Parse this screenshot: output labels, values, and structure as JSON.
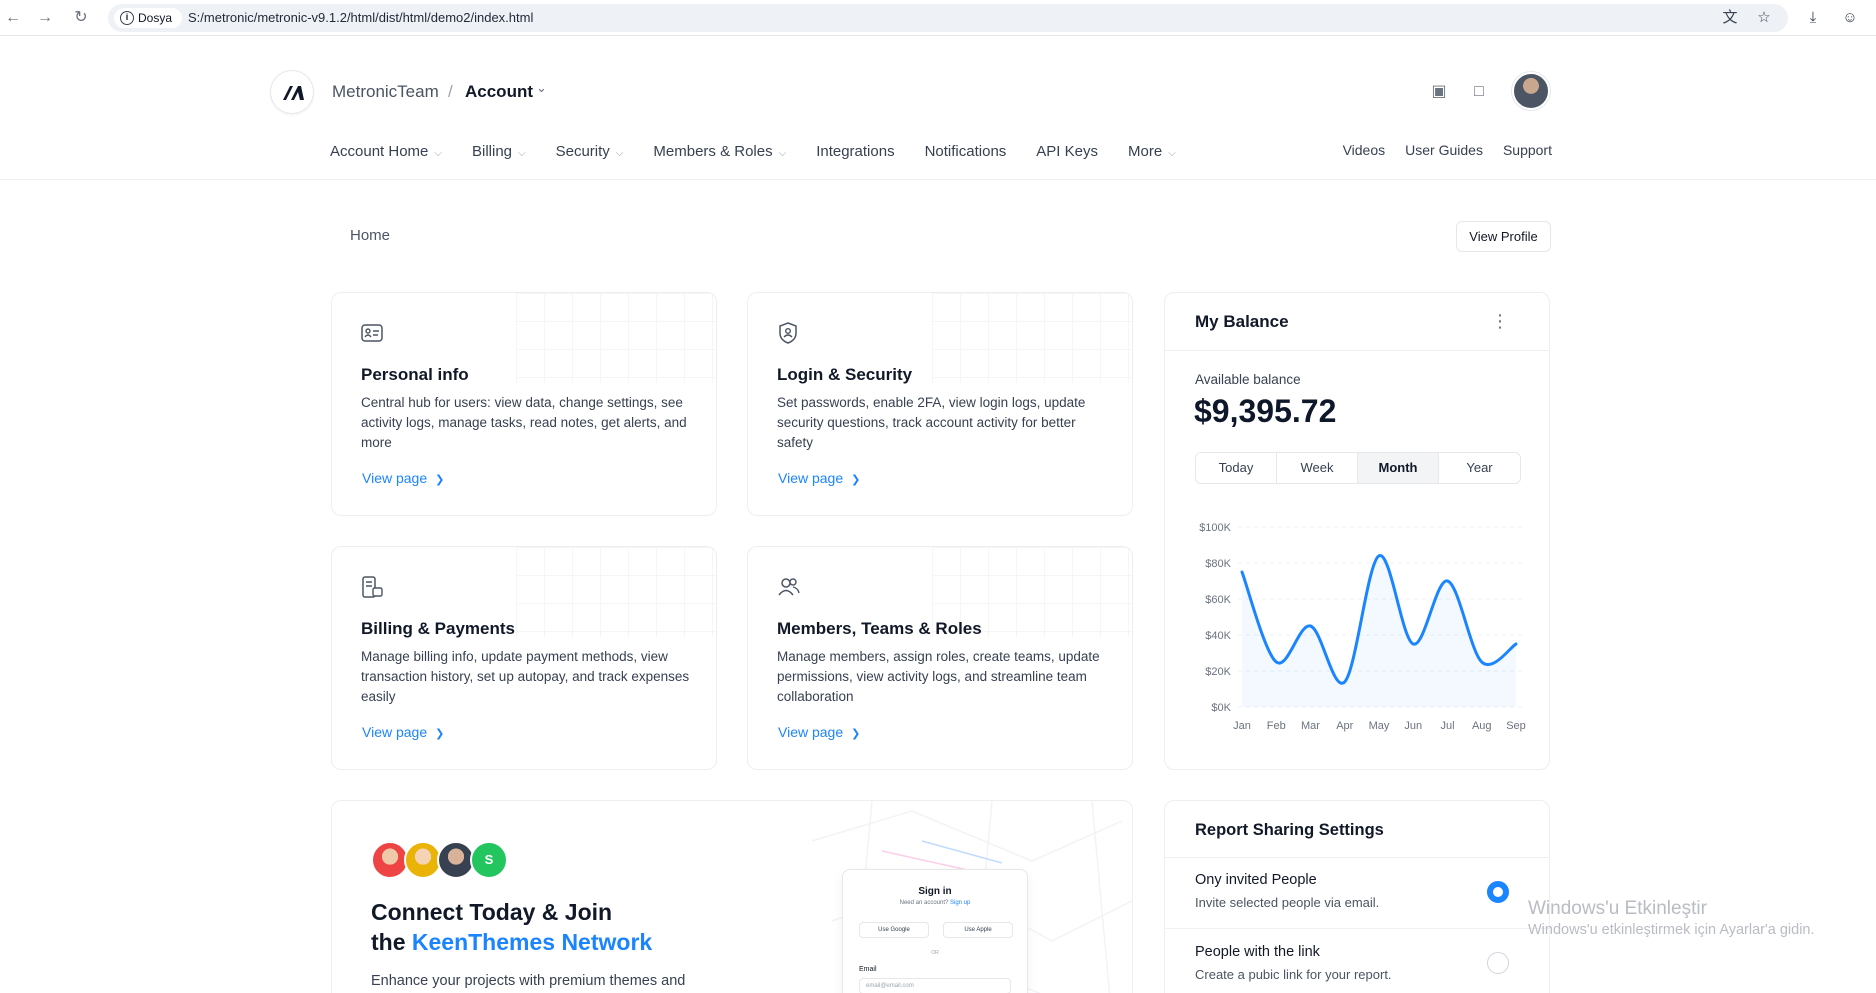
{
  "browser": {
    "site_label": "Dosya",
    "url": "S:/metronic/metronic-v9.1.2/html/dist/html/demo2/index.html"
  },
  "header": {
    "team": "MetronicTeam",
    "separator": "/",
    "account": "Account"
  },
  "nav": {
    "items": [
      {
        "label": "Account Home",
        "dropdown": true
      },
      {
        "label": "Billing",
        "dropdown": true
      },
      {
        "label": "Security",
        "dropdown": true
      },
      {
        "label": "Members & Roles",
        "dropdown": true
      },
      {
        "label": "Integrations",
        "dropdown": false
      },
      {
        "label": "Notifications",
        "dropdown": false
      },
      {
        "label": "API Keys",
        "dropdown": false
      },
      {
        "label": "More",
        "dropdown": true
      }
    ],
    "side": [
      "Videos",
      "User Guides",
      "Support"
    ]
  },
  "page": {
    "breadcrumb": "Home",
    "view_profile": "View Profile"
  },
  "cards": [
    {
      "icon": "id-card-icon",
      "title": "Personal info",
      "desc": "Central hub for users: view data, change settings, see activity logs, manage tasks, read notes, get alerts, and more",
      "link": "View page"
    },
    {
      "icon": "shield-user-icon",
      "title": "Login & Security",
      "desc": "Set passwords, enable 2FA, view login logs, update security questions, track account activity for better safety",
      "link": "View page"
    },
    {
      "icon": "billing-icon",
      "title": "Billing & Payments",
      "desc": "Manage billing info, update payment methods, view transaction history, set up autopay, and track expenses easily",
      "link": "View page"
    },
    {
      "icon": "users-icon",
      "title": "Members, Teams & Roles",
      "desc": "Manage members, assign roles, create teams, update permissions, view activity logs, and streamline team collaboration",
      "link": "View page"
    }
  ],
  "balance": {
    "title": "My Balance",
    "available_label": "Available balance",
    "amount": "$9,395.72",
    "periods": [
      "Today",
      "Week",
      "Month",
      "Year"
    ],
    "active_period": "Month"
  },
  "chart_data": {
    "type": "line",
    "x": [
      "Jan",
      "Feb",
      "Mar",
      "Apr",
      "May",
      "Jun",
      "Jul",
      "Aug",
      "Sep"
    ],
    "series": [
      {
        "values": [
          75,
          25,
          45,
          14,
          84,
          35,
          70,
          25,
          35
        ]
      }
    ],
    "ylim": [
      0,
      100
    ],
    "yticks": [
      "$0K",
      "$20K",
      "$40K",
      "$60K",
      "$80K",
      "$100K"
    ],
    "grid": true,
    "color": "#1b84ff"
  },
  "promo": {
    "avatar_initial": "S",
    "title_line1": "Connect Today & Join",
    "title_prefix": "the ",
    "title_highlight": "KeenThemes Network",
    "desc": "Enhance your projects with premium themes and",
    "mock": {
      "title": "Sign in",
      "subtitle": "Need an account?",
      "signup": "Sign up",
      "google": "Use Google",
      "apple": "Use Apple",
      "or": "OR",
      "email_label": "Email",
      "email_placeholder": "email@email.com"
    }
  },
  "report": {
    "title": "Report Sharing Settings",
    "options": [
      {
        "title": "Ony invited People",
        "desc": "Invite selected people via email.",
        "selected": true
      },
      {
        "title": "People with the link",
        "desc": "Create a pubic link for your report.",
        "selected": false
      }
    ]
  },
  "watermark": {
    "line1": "Windows'u Etkinleştir",
    "line2": "Windows'u etkinleştirmek için Ayarlar'a gidin."
  }
}
